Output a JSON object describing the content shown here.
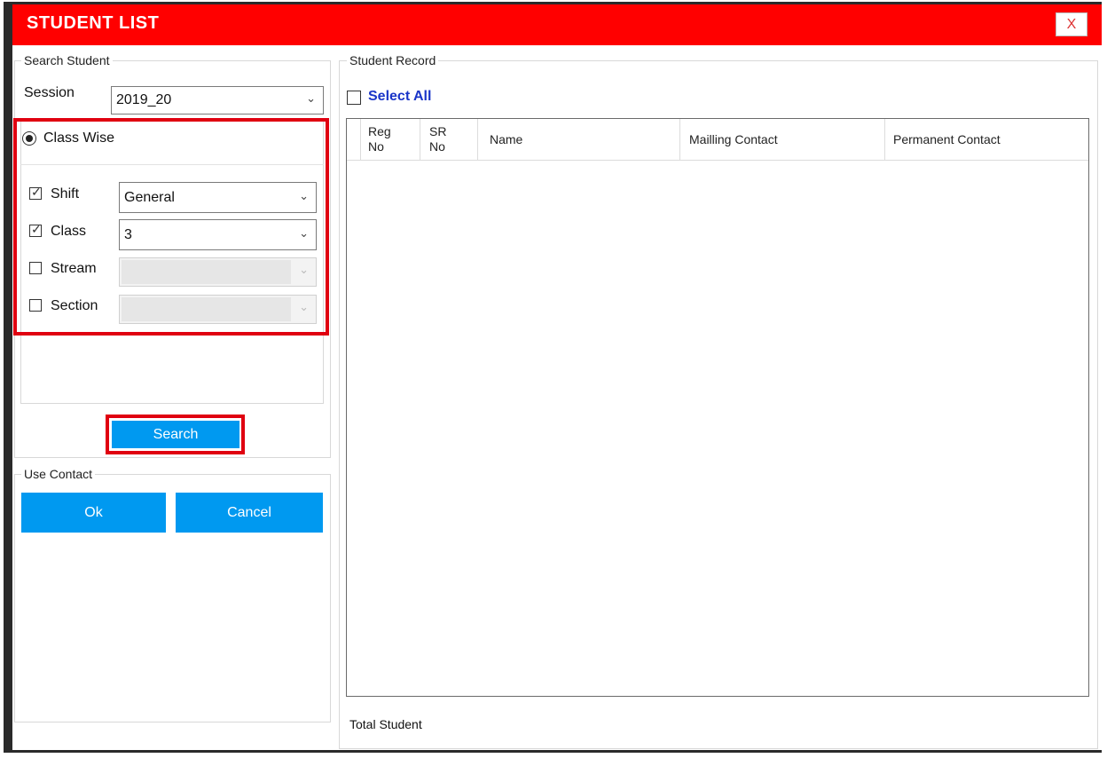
{
  "window": {
    "title": "STUDENT LIST",
    "close_label": "X"
  },
  "search_student": {
    "legend": "Search Student",
    "session_label": "Session",
    "session_value": "2019_20",
    "mode_label": "Class Wise",
    "filters": [
      {
        "label": "Shift",
        "checked": true,
        "value": "General"
      },
      {
        "label": "Class",
        "checked": true,
        "value": "3"
      },
      {
        "label": "Stream",
        "checked": false,
        "value": ""
      },
      {
        "label": "Section",
        "checked": false,
        "value": ""
      }
    ],
    "search_label": "Search"
  },
  "use_contact": {
    "legend": "Use Contact",
    "ok_label": "Ok",
    "cancel_label": "Cancel"
  },
  "student_record": {
    "legend": "Student Record",
    "select_all_label": "Select All",
    "columns": [
      {
        "line1": "Reg",
        "line2": "No"
      },
      {
        "line1": "SR",
        "line2": "No"
      },
      {
        "line1": "Name",
        "line2": ""
      },
      {
        "line1": "Mailling Contact",
        "line2": ""
      },
      {
        "line1": "Permanent Contact",
        "line2": ""
      }
    ],
    "total_label": "Total Student"
  },
  "colors": {
    "titlebar": "#ff0000",
    "button": "#0099f0",
    "highlight": "#e00010",
    "select_all_text": "#1a35c8"
  },
  "icons": {
    "dropdown": "chevron-down-icon",
    "check": "check-icon"
  }
}
